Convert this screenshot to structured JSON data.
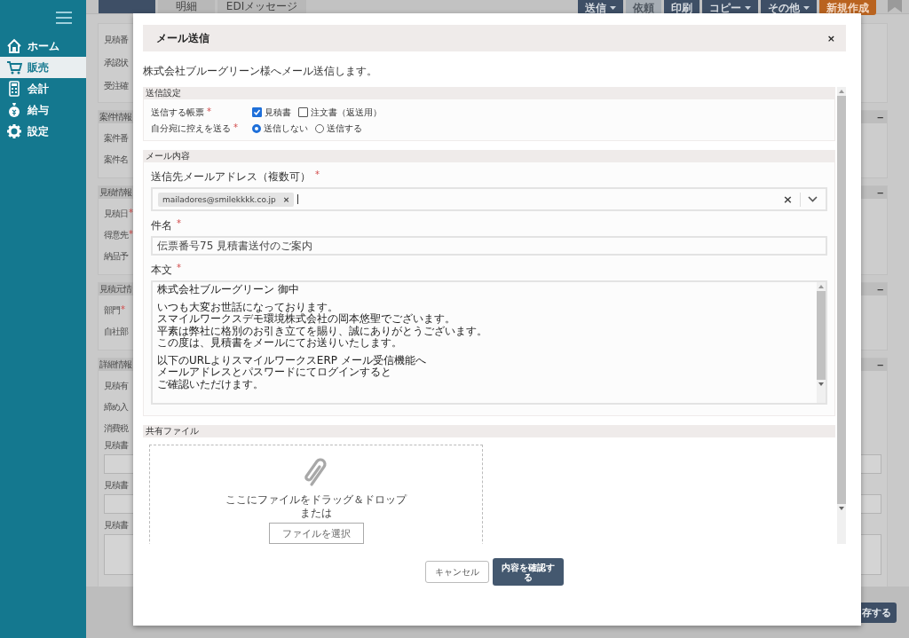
{
  "sidebar": {
    "items": [
      {
        "label": "ホーム",
        "selected": false
      },
      {
        "label": "販売",
        "selected": true
      },
      {
        "label": "会計",
        "selected": false
      },
      {
        "label": "給与",
        "selected": false
      },
      {
        "label": "設定",
        "selected": false
      }
    ]
  },
  "tabs": [
    {
      "selected": true
    },
    {
      "label": "明細",
      "selected": false
    },
    {
      "label": "EDIメッセージ",
      "selected": false
    }
  ],
  "toolbar": [
    {
      "label": "送信",
      "kind": "dropdown",
      "disabled": false
    },
    {
      "label": "依頼",
      "kind": "plain",
      "disabled": true
    },
    {
      "label": "印刷",
      "kind": "plain",
      "disabled": false
    },
    {
      "label": "コピー",
      "kind": "dropdown",
      "disabled": false
    },
    {
      "label": "その他",
      "kind": "dropdown",
      "disabled": false
    },
    {
      "label": "新規作成",
      "kind": "accent",
      "disabled": false
    }
  ],
  "background_form": {
    "sections": [
      {
        "rows": [
          {
            "label": "見積番",
            "kind": "text"
          },
          {
            "label": "承認状",
            "kind": "text"
          },
          {
            "label": "受注確",
            "kind": "text"
          }
        ]
      },
      {
        "title": "案件情報",
        "collapse": "−",
        "rows": [
          {
            "label": "案件番",
            "kind": "text"
          },
          {
            "label": "案件名",
            "kind": "text"
          }
        ]
      },
      {
        "title": "見積情報",
        "collapse": "−",
        "rows": [
          {
            "label": "見積日",
            "required_mark": "*",
            "kind": "text"
          },
          {
            "label": "得意先",
            "required_mark": "*",
            "kind": "text"
          },
          {
            "label": "納品予",
            "kind": "text"
          }
        ]
      },
      {
        "title": "見積元情",
        "collapse": "−",
        "rows": [
          {
            "label": "部門",
            "required_mark": "*",
            "kind": "text"
          },
          {
            "label": "自社部",
            "kind": "text"
          }
        ]
      },
      {
        "title": "詳細情報",
        "collapse": "−",
        "rows": [
          {
            "label": "見積有",
            "kind": "text"
          },
          {
            "label": "締め入",
            "kind": "text"
          },
          {
            "label": "消費税",
            "kind": "text"
          },
          {
            "label": "見積書",
            "kind": "box"
          },
          {
            "label": "見積書",
            "kind": "box"
          },
          {
            "label": "見積書",
            "kind": "tall"
          }
        ]
      }
    ],
    "save_button": "存する"
  },
  "dialog": {
    "title": "メール送信",
    "close": "×",
    "intro": "株式会社ブルーグリーン様へメール送信します。",
    "sections": [
      {
        "title": "送信設定",
        "kind": "options",
        "rows": [
          {
            "label": "送信する帳票",
            "required_mark": "*",
            "kind": "checkbox",
            "options": [
              {
                "label": "見積書",
                "checked": true
              },
              {
                "label": "注文書（返送用）",
                "checked": false
              }
            ]
          },
          {
            "label": "自分宛に控えを送る",
            "required_mark": "*",
            "kind": "radio",
            "options": [
              {
                "label": "送信しない",
                "selected": true
              },
              {
                "label": "送信する",
                "selected": false
              }
            ]
          }
        ]
      },
      {
        "title": "メール内容",
        "kind": "mail",
        "fields": [
          {
            "label": "送信先メールアドレス（複数可）",
            "required_mark": "*",
            "kind": "tags",
            "tags": [
              {
                "text": "mailadores@smilekkkk.co.jp",
                "remove": "×"
              }
            ],
            "clear": "×"
          },
          {
            "label": "件名",
            "required_mark": "*",
            "kind": "input",
            "value": "伝票番号75 見積書送付のご案内"
          },
          {
            "label": "本文",
            "required_mark": "*",
            "kind": "textarea",
            "paragraphs": [
              [
                "株式会社ブルーグリーン 御中"
              ],
              [
                "いつも大変お世話になっております。",
                "スマイルワークスデモ環境株式会社の岡本悠聖でございます。",
                "平素は弊社に格別のお引き立てを賜り、誠にありがとうございます。",
                "この度は、見積書をメールにてお送りいたします。"
              ],
              [
                "以下のURLよりスマイルワークスERP メール受信機能へ",
                "メールアドレスとパスワードにてログインすると",
                "ご確認いただけます。"
              ]
            ]
          }
        ]
      },
      {
        "title": "共有ファイル",
        "kind": "files",
        "drop_text": "ここにファイルをドラッグ＆ドロップ",
        "or_text": "または",
        "button": "ファイルを選択"
      }
    ],
    "buttons": [
      {
        "label": "キャンセル",
        "kind": "secondary"
      },
      {
        "label": "内容を確認する",
        "kind": "primary"
      }
    ]
  }
}
